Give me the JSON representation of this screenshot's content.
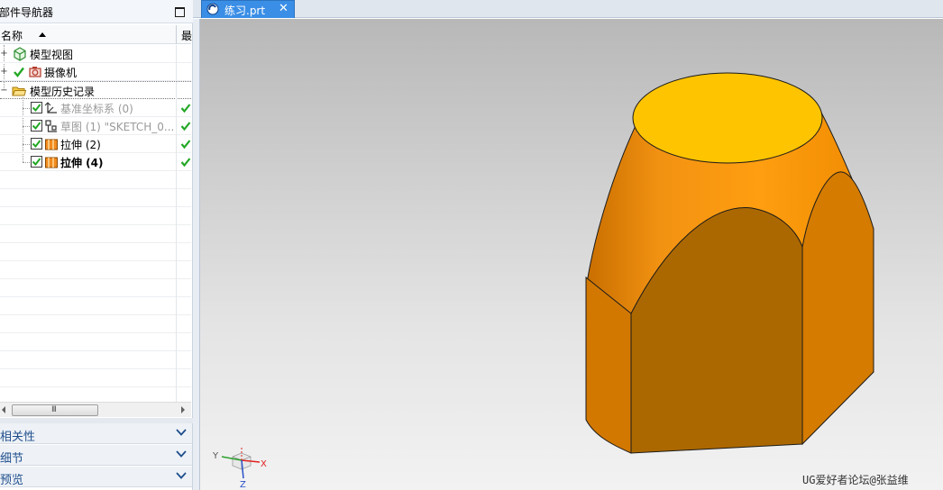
{
  "navigator": {
    "title": "部件导航器",
    "columns": {
      "name": "名称",
      "last": "最"
    },
    "rows": [
      {
        "label": "模型视图",
        "icon": "model-views-icon",
        "style": "normal"
      },
      {
        "label": "摄像机",
        "icon": "camera-icon",
        "style": "normal"
      },
      {
        "label": "模型历史记录",
        "icon": "folder-icon",
        "style": "normal"
      },
      {
        "label": "基准坐标系 (0)",
        "icon": "datum-csys-icon",
        "style": "grey"
      },
      {
        "label": "草图 (1) \"SKETCH_0...",
        "icon": "sketch-icon",
        "style": "grey"
      },
      {
        "label": "拉伸 (2)",
        "icon": "extrude-icon",
        "style": "normal"
      },
      {
        "label": "拉伸 (4)",
        "icon": "extrude-icon",
        "style": "bold"
      }
    ],
    "scrollbar_grip": "III",
    "sections": [
      {
        "label": "相关性"
      },
      {
        "label": "细节"
      },
      {
        "label": "预览"
      }
    ]
  },
  "tab": {
    "label": "练习.prt",
    "close": "✕"
  },
  "triad": {
    "x": "X",
    "y": "Y",
    "z": "Z"
  },
  "watermark": "UG爱好者论坛@张益维",
  "colors": {
    "accent_tab": "#3a8ee6",
    "check_green": "#22a824",
    "model_orange": "#e98a06",
    "model_top": "#ffc400",
    "section_text": "#1e4e8c"
  }
}
